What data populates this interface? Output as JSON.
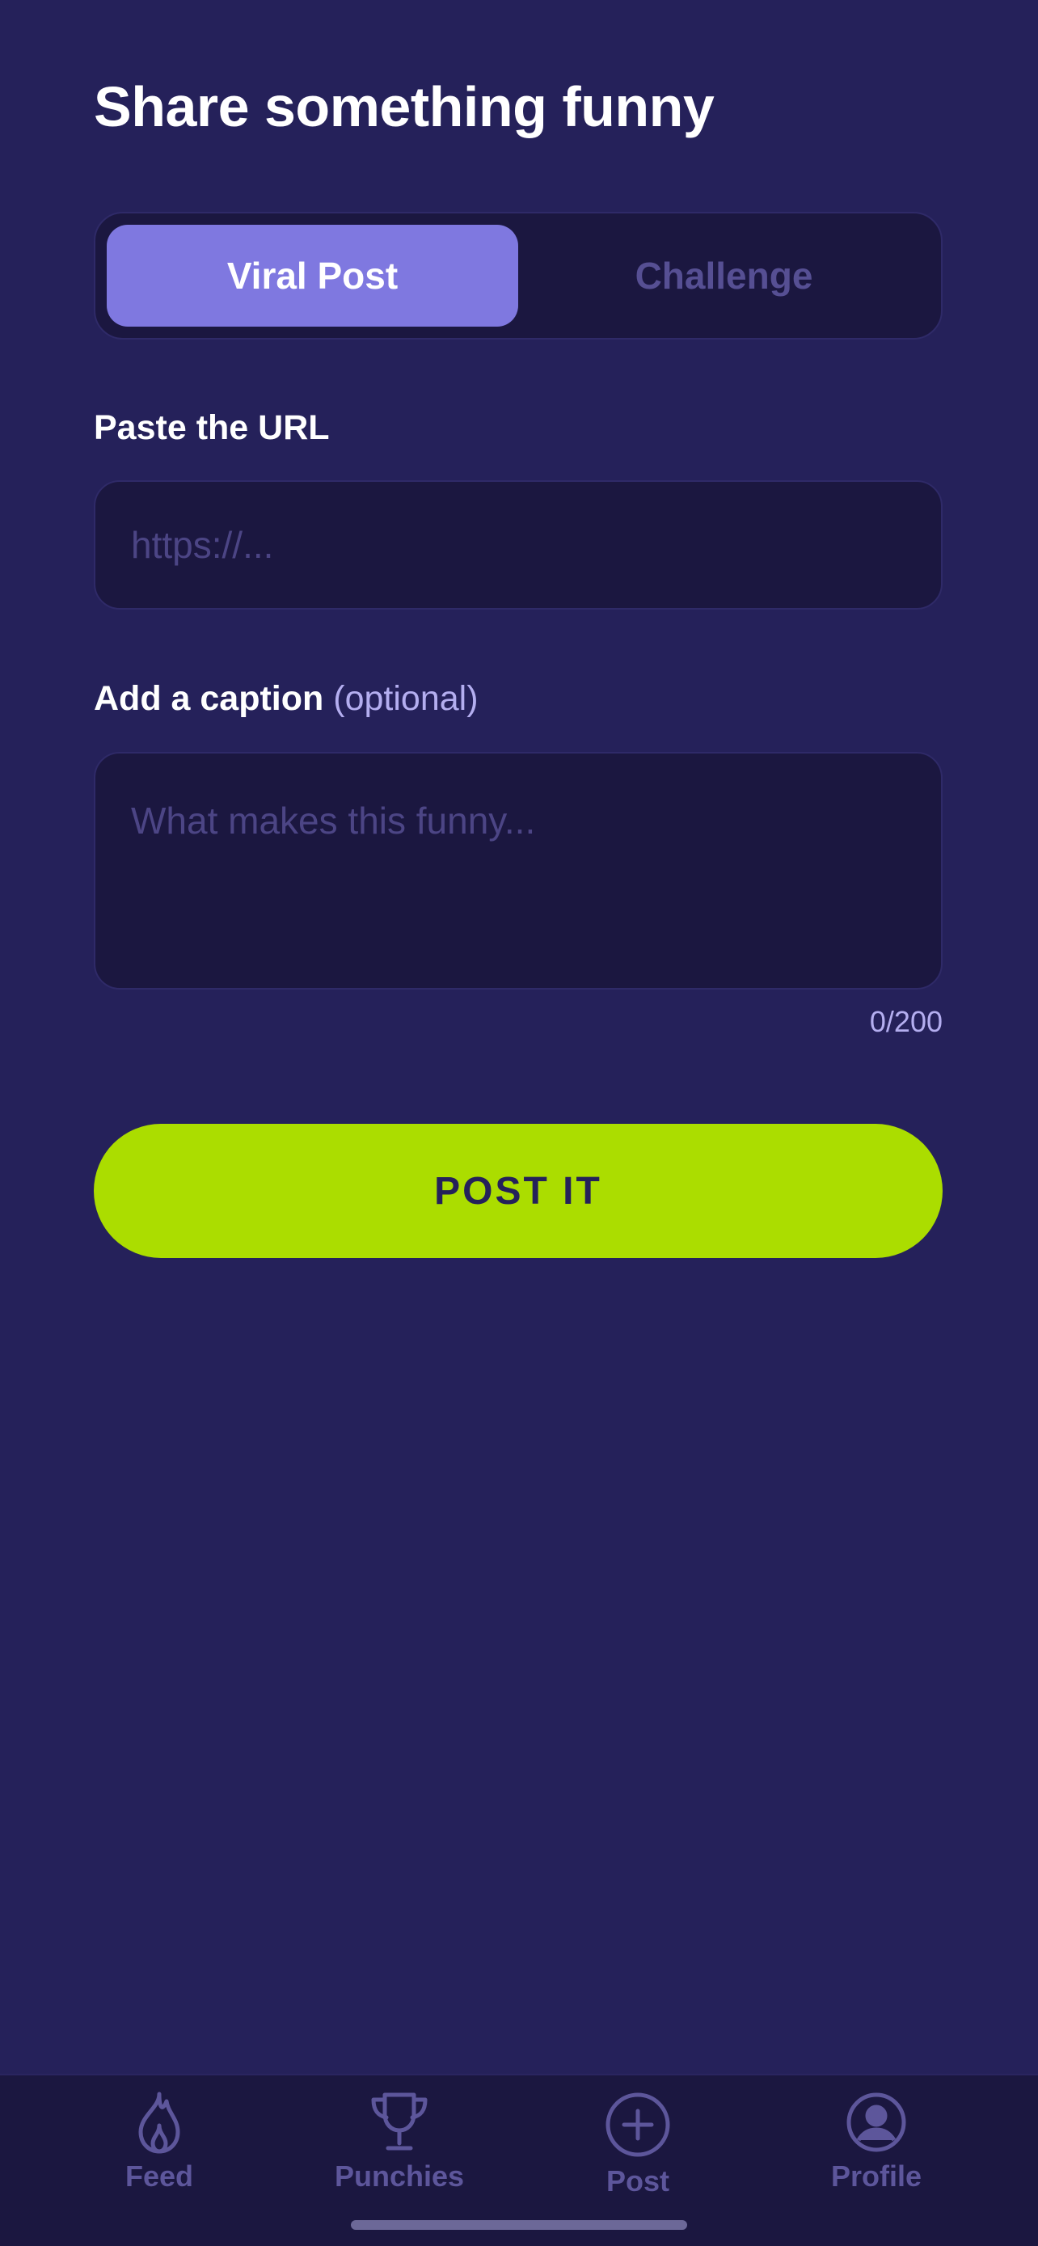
{
  "header": {
    "title": "Share something funny"
  },
  "segmented": {
    "tabs": [
      {
        "label": "Viral Post",
        "active": true
      },
      {
        "label": "Challenge",
        "active": false
      }
    ]
  },
  "url_field": {
    "label": "Paste the URL",
    "value": "",
    "placeholder": "https://..."
  },
  "caption_field": {
    "label": "Add a caption",
    "label_suffix": "(optional)",
    "value": "",
    "placeholder": "What makes this funny...",
    "counter": "0/200"
  },
  "submit": {
    "label": "POST IT"
  },
  "tabbar": {
    "items": [
      {
        "label": "Feed",
        "icon": "flame-icon"
      },
      {
        "label": "Punchies",
        "icon": "trophy-icon"
      },
      {
        "label": "Post",
        "icon": "plus-circle-icon"
      },
      {
        "label": "Profile",
        "icon": "user-circle-icon"
      }
    ]
  },
  "colors": {
    "background": "#25215a",
    "surface": "#1b1740",
    "accent": "#7f78e0",
    "cta": "#abdd00",
    "inactive": "#5d569b"
  }
}
